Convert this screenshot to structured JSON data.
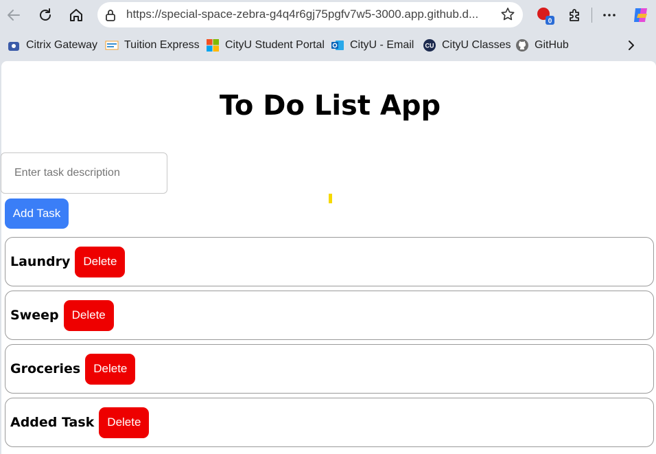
{
  "browser": {
    "url": "https://special-space-zebra-g4q4r6gj75pgfv7w5-3000.app.github.d...",
    "extension_badge": "0",
    "bookmarks": [
      {
        "label": "Citrix Gateway",
        "icon": "citrix-icon"
      },
      {
        "label": "Tuition Express",
        "icon": "tuition-express-icon"
      },
      {
        "label": "CityU Student Portal",
        "icon": "microsoft-icon"
      },
      {
        "label": "CityU - Email",
        "icon": "outlook-icon"
      },
      {
        "label": "CityU Classes",
        "icon": "cityu-icon"
      },
      {
        "label": "GitHub",
        "icon": "github-icon"
      }
    ]
  },
  "app": {
    "title": "To Do List App",
    "input": {
      "placeholder": "Enter task description",
      "value": ""
    },
    "add_button_label": "Add Task",
    "delete_label": "Delete",
    "tasks": [
      "Laundry",
      "Sweep",
      "Groceries",
      "Added Task"
    ]
  },
  "colors": {
    "add_button": "#3a7ef7",
    "delete_button": "#ee0000",
    "chrome_background": "#dfe3e9"
  }
}
